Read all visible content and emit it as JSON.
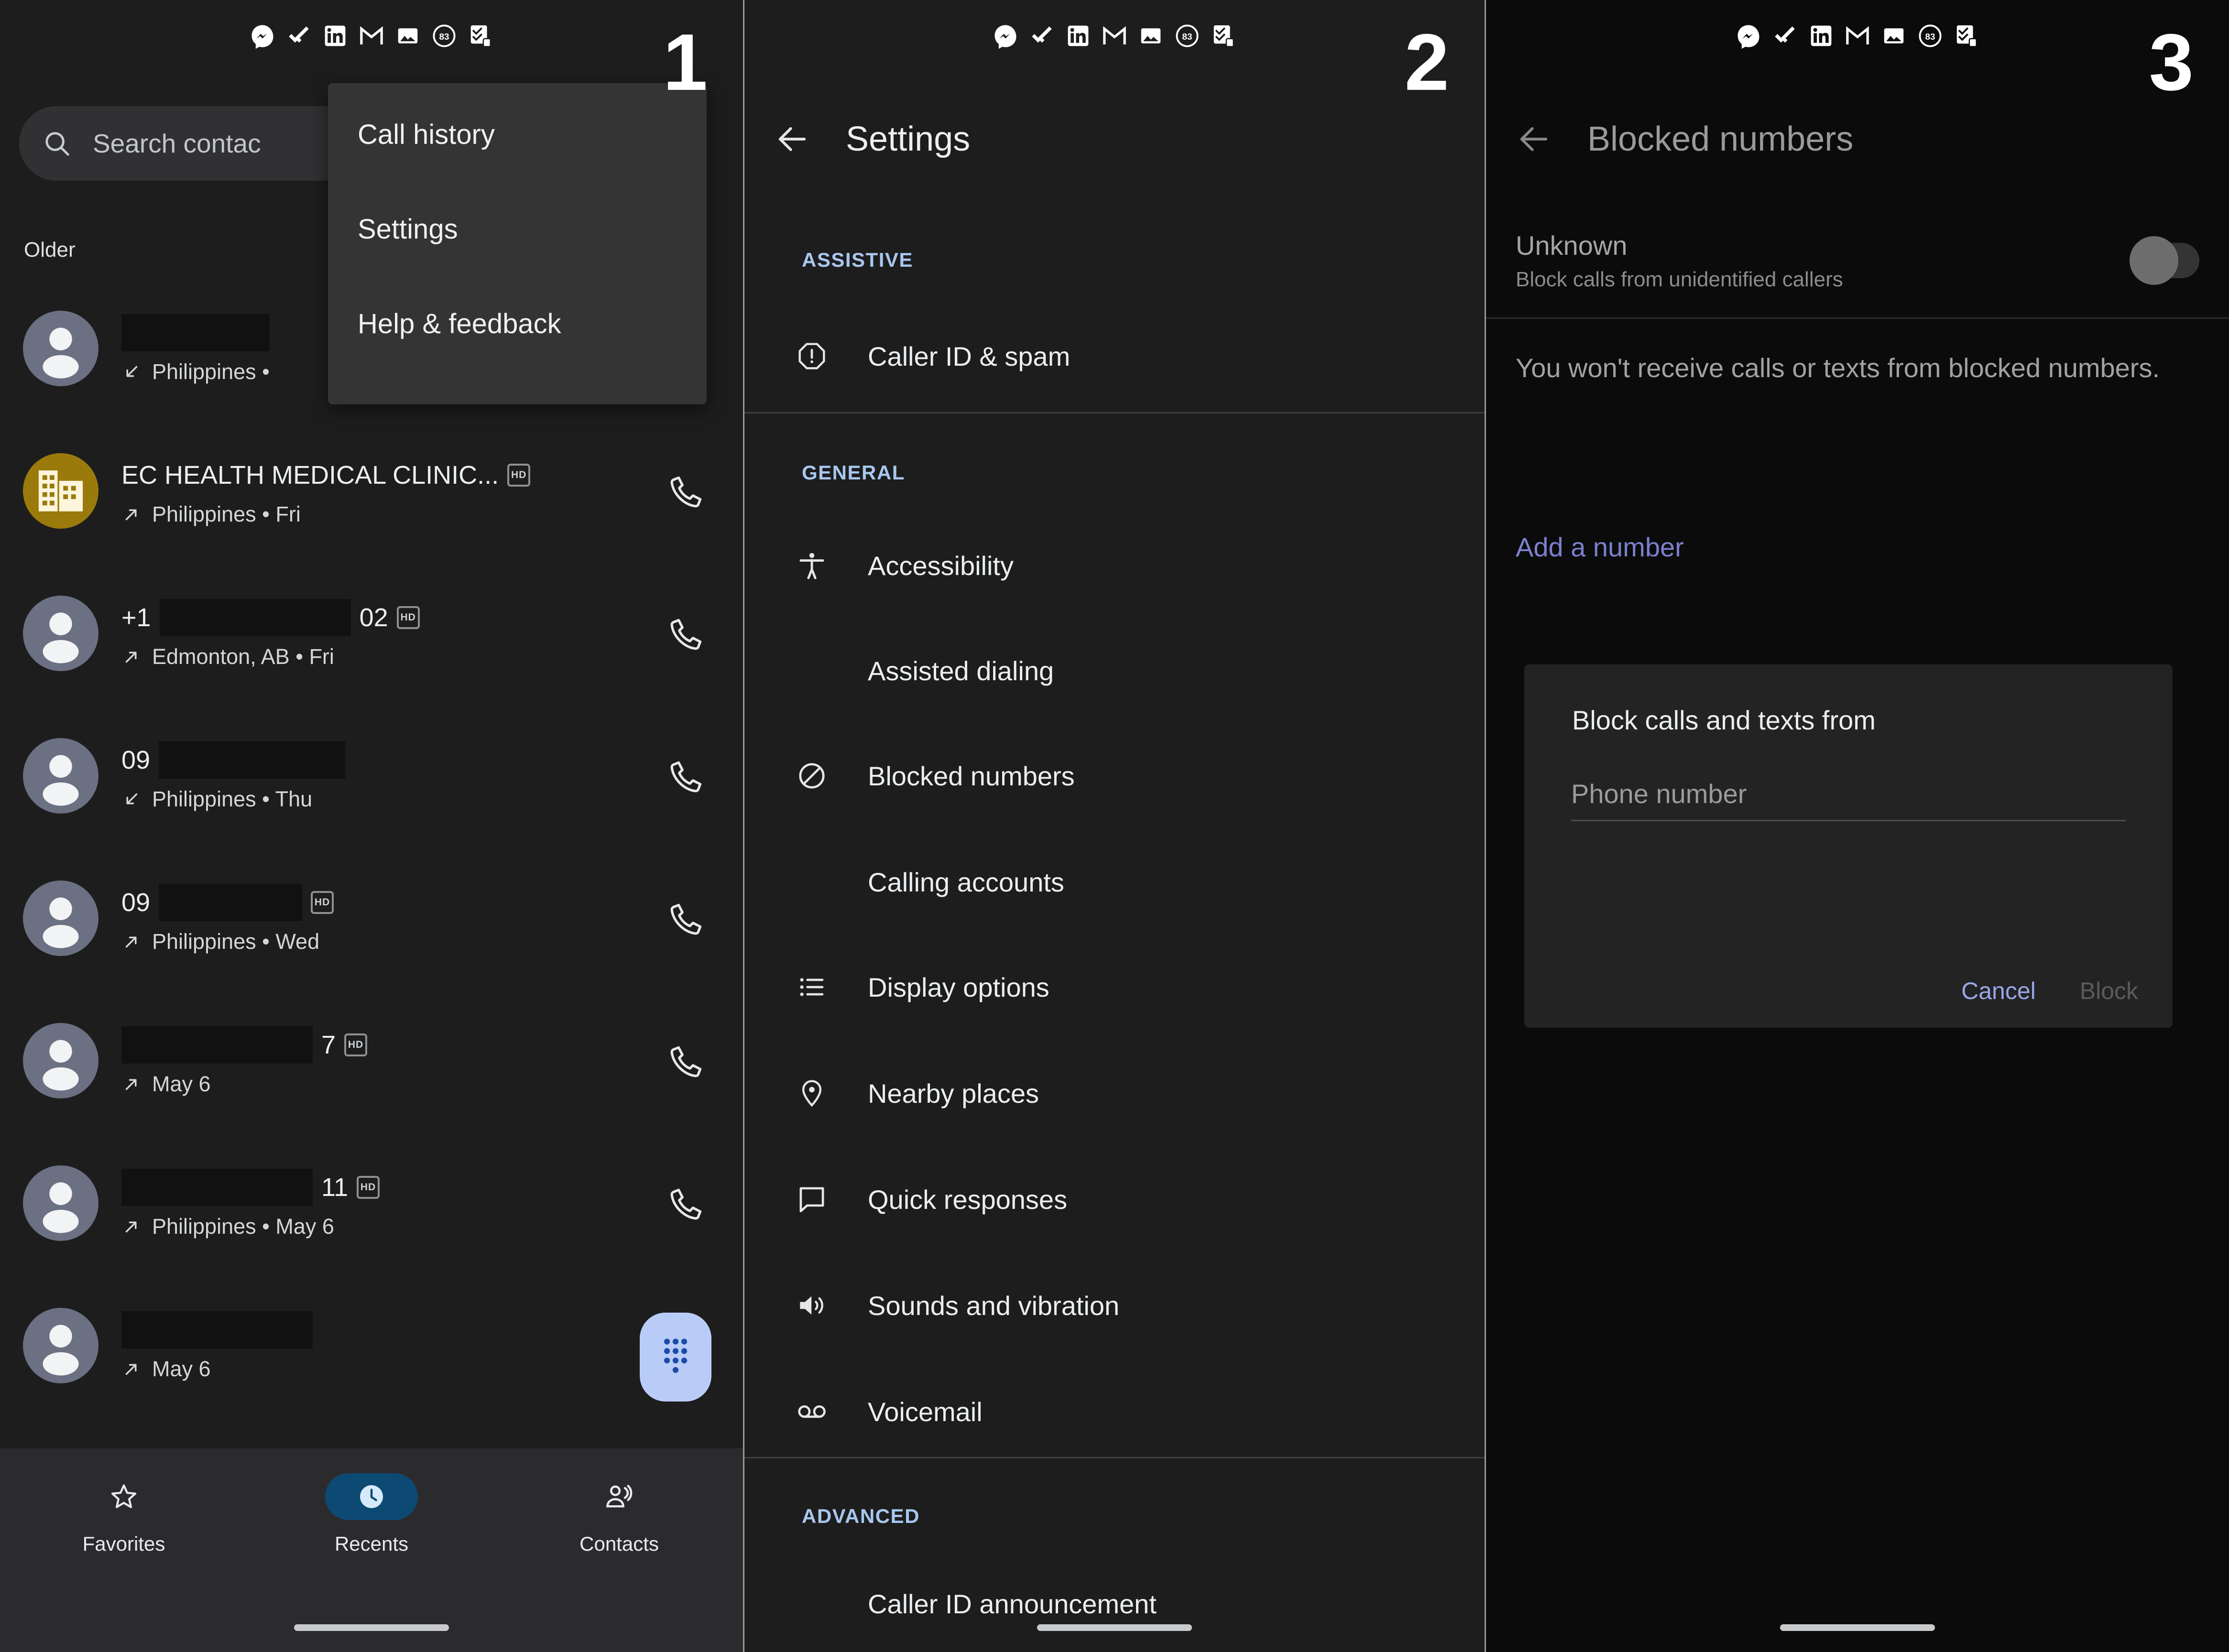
{
  "status_bar": {
    "icons": [
      "messenger-icon",
      "todoist-check-icon",
      "linkedin-icon",
      "gmail-icon",
      "photos-icon",
      "badge-83-icon",
      "tasks-icon"
    ],
    "badge_count": "83"
  },
  "colors": {
    "panel_bg": "#1d1d1d",
    "panel3_bg": "#0b0b0b",
    "accent_blue": "#a8c7ef",
    "link_blue": "#7b80cf",
    "fab_bg": "#b9ccf7",
    "active_nav_bg": "#0c4a73",
    "business_avatar": "#9b7a0c",
    "person_avatar": "#6b7082"
  },
  "panel1": {
    "step": "1",
    "search": {
      "placeholder": "Search contac"
    },
    "section_label": "Older",
    "overflow_menu": {
      "items": [
        {
          "label": "Call history"
        },
        {
          "label": "Settings"
        },
        {
          "label": "Help & feedback"
        }
      ]
    },
    "calls": [
      {
        "name": "",
        "redacted": true,
        "redact_w": 310,
        "hd": false,
        "direction": "incoming",
        "detail": "Philippines •",
        "show_call": false
      },
      {
        "name": "EC HEALTH MEDICAL CLINIC...",
        "redacted": false,
        "hd": true,
        "direction": "outgoing",
        "detail": "Philippines • Fri",
        "show_call": true,
        "avatar": "business"
      },
      {
        "name": "+1",
        "redacted": true,
        "redact_w": 400,
        "suffix": "02",
        "hd": true,
        "direction": "outgoing",
        "detail": "Edmonton, AB • Fri",
        "show_call": true
      },
      {
        "name": "09",
        "redacted": true,
        "redact_w": 390,
        "hd": false,
        "direction": "incoming",
        "detail": "Philippines • Thu",
        "show_call": true
      },
      {
        "name": "09",
        "redacted": true,
        "redact_w": 390,
        "hd": true,
        "direction": "outgoing",
        "detail": "Philippines • Wed",
        "show_call": true
      },
      {
        "name": "",
        "redacted": true,
        "redact_w": 400,
        "suffix": "7",
        "hd": true,
        "direction": "outgoing",
        "detail": "May 6",
        "show_call": true
      },
      {
        "name": "",
        "redacted": true,
        "redact_w": 400,
        "suffix": "11",
        "hd": true,
        "direction": "outgoing",
        "detail": "Philippines • May 6",
        "show_call": true
      },
      {
        "name": "",
        "redacted": true,
        "redact_w": 400,
        "hd": false,
        "direction": "outgoing",
        "detail": "May 6",
        "show_call": false
      }
    ],
    "dialpad_fab": "dialpad-icon",
    "bottom_nav": [
      {
        "label": "Favorites",
        "icon": "star-icon",
        "active": false
      },
      {
        "label": "Recents",
        "icon": "clock-icon",
        "active": true
      },
      {
        "label": "Contacts",
        "icon": "people-icon",
        "active": false
      }
    ]
  },
  "panel2": {
    "step": "2",
    "title": "Settings",
    "back": "back-arrow-icon",
    "sections": [
      {
        "heading": "ASSISTIVE",
        "items": [
          {
            "label": "Caller ID & spam",
            "icon": "alert-octagon-icon"
          }
        ]
      },
      {
        "heading": "GENERAL",
        "items": [
          {
            "label": "Accessibility",
            "icon": "accessibility-icon"
          },
          {
            "label": "Assisted dialing",
            "icon": ""
          },
          {
            "label": "Blocked numbers",
            "icon": "block-icon"
          },
          {
            "label": "Calling accounts",
            "icon": ""
          },
          {
            "label": "Display options",
            "icon": "list-icon"
          },
          {
            "label": "Nearby places",
            "icon": "location-pin-icon"
          },
          {
            "label": "Quick responses",
            "icon": "chat-bubble-icon"
          },
          {
            "label": "Sounds and vibration",
            "icon": "volume-icon"
          },
          {
            "label": "Voicemail",
            "icon": "voicemail-icon"
          }
        ]
      },
      {
        "heading": "ADVANCED",
        "items": [
          {
            "label": "Caller ID announcement",
            "icon": ""
          }
        ]
      }
    ]
  },
  "panel3": {
    "step": "3",
    "title": "Blocked numbers",
    "back": "back-arrow-icon",
    "unknown": {
      "title": "Unknown",
      "subtitle": "Block calls from unidentified callers",
      "toggle_on": false
    },
    "description": "You won't receive calls or texts from blocked numbers.",
    "add_number": "Add a number",
    "dialog": {
      "title": "Block calls and texts from",
      "field_placeholder": "Phone number",
      "field_value": "",
      "cancel_label": "Cancel",
      "block_label": "Block"
    }
  }
}
